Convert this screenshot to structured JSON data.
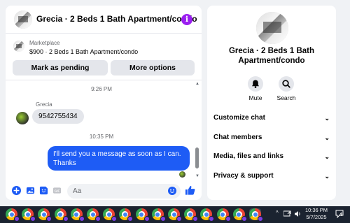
{
  "chat": {
    "title": "Grecia · 2 Beds 1 Bath Apartment/condo",
    "info_icon": "i",
    "marketplace": {
      "label": "Marketplace",
      "listing": "$900 · 2 Beds 1 Bath Apartment/condo"
    },
    "buttons": {
      "mark_pending": "Mark as pending",
      "more_options": "More options"
    },
    "messages": [
      {
        "type": "timestamp",
        "text": "9:26 PM"
      },
      {
        "type": "incoming",
        "sender": "Grecia",
        "text": "9542755434"
      },
      {
        "type": "timestamp",
        "text": "10:35 PM"
      },
      {
        "type": "outgoing",
        "text": "I'll send you a message as soon as I can. Thanks"
      }
    ],
    "composer": {
      "placeholder": "Aa",
      "icons": [
        "plus-icon",
        "photo-icon",
        "sticker-icon",
        "gif-icon",
        "emoji-icon",
        "thumbs-up-icon"
      ]
    }
  },
  "info_panel": {
    "title": "Grecia · 2 Beds 1 Bath Apartment/condo",
    "actions": [
      {
        "label": "Mute",
        "icon": "bell-icon"
      },
      {
        "label": "Search",
        "icon": "search-icon"
      }
    ],
    "sections": [
      "Customize chat",
      "Chat members",
      "Media, files and links",
      "Privacy & support"
    ]
  },
  "taskbar": {
    "app_icon": "chrome-icon",
    "app_count": 16,
    "time": "10:36 PM",
    "date": "5/7/2025",
    "notifications": "4"
  },
  "colors": {
    "accent": "#1e5cf5",
    "info_button": "#9b1ff0",
    "background": "#f0f2f5",
    "taskbar": "#1b2330"
  }
}
